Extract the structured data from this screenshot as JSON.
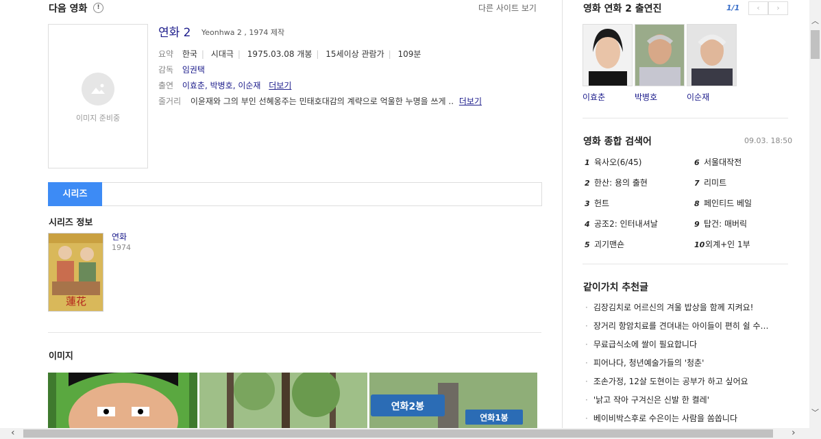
{
  "header": {
    "title": "다음 영화",
    "info": "!",
    "other_sites": "다른 사이트 보기"
  },
  "poster": {
    "placeholder": "이미지 준비중"
  },
  "movie": {
    "title": "연화 2",
    "subtitle": "Yeonhwa 2 , 1974 제작",
    "summary_label": "요약",
    "summary": [
      "한국",
      "시대극",
      "1975.03.08 개봉",
      "15세이상 관람가",
      "109분"
    ],
    "director_label": "감독",
    "director": "임권택",
    "cast_label": "출연",
    "cast": "이효춘, 박병호, 이순재",
    "more": "더보기",
    "plot_label": "줄거리",
    "plot": "이윤재와 그의 부인 선혜옹주는 민태호대감의 계략으로 억울한 누명을 쓰게 ..",
    "plot_more": "더보기"
  },
  "tabs": {
    "active": "시리즈"
  },
  "series": {
    "heading": "시리즈 정보",
    "name": "연화",
    "year": "1974"
  },
  "images": {
    "heading": "이미지"
  },
  "right": {
    "cast_title": "영화 연화 2 출연진",
    "pager": "1/1",
    "prev": "‹",
    "next": "›",
    "cast": [
      "이효춘",
      "박병호",
      "이순재"
    ],
    "ranking_title": "영화 종합 검색어",
    "ranking_time": "09.03. 18:50",
    "ranking": [
      {
        "n": "1",
        "t": "육사오(6/45)"
      },
      {
        "n": "2",
        "t": "한산: 용의 출현"
      },
      {
        "n": "3",
        "t": "헌트"
      },
      {
        "n": "4",
        "t": "공조2: 인터내셔날"
      },
      {
        "n": "5",
        "t": "괴기맨숀"
      },
      {
        "n": "6",
        "t": "서울대작전"
      },
      {
        "n": "7",
        "t": "리미트"
      },
      {
        "n": "8",
        "t": "페인티드 베일"
      },
      {
        "n": "9",
        "t": "탑건: 매버릭"
      },
      {
        "n": "10",
        "t": "외계+인 1부"
      }
    ],
    "rec_title": "같이가치 추천글",
    "rec": [
      "김장김치로 어르신의 겨울 밥상을 함께 지켜요!",
      "장거리 항암치료를 견뎌내는 아이들이 편히 쉴 수…",
      "무료급식소에 쌀이 필요합니다",
      "피어나다, 청년예술가들의 '청춘'",
      "조손가정, 12살 도현이는 공부가 하고 싶어요",
      "'낡고 작아 구겨신은 신발 한 켤레'",
      "베이비박스후로 수은이는 사람을 쏨쏩니다"
    ]
  },
  "scrollbars": {
    "up": "︿",
    "down": "﹀",
    "left": "‹",
    "right": "›"
  }
}
